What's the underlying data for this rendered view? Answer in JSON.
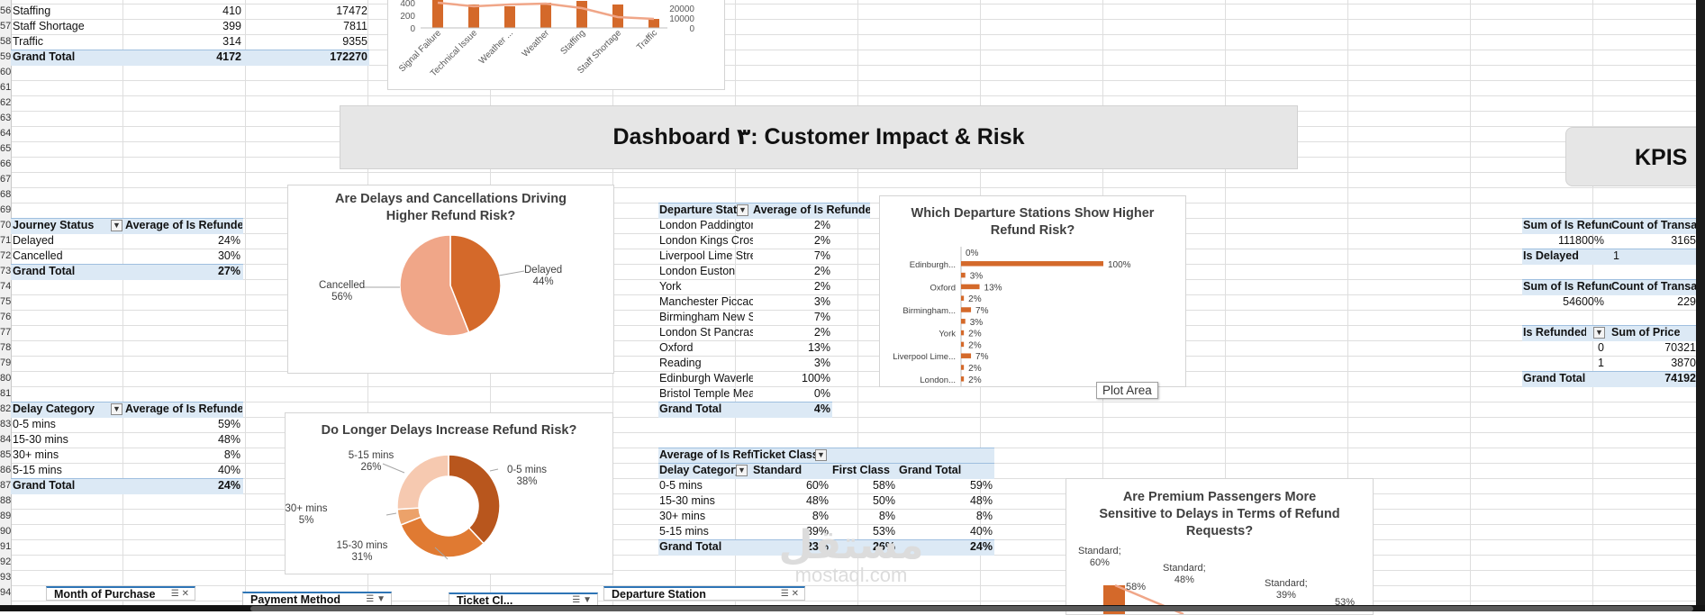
{
  "row_numbers": [
    "56",
    "57",
    "58",
    "59",
    "60",
    "61",
    "62",
    "63",
    "64",
    "65",
    "66",
    "67",
    "68",
    "69",
    "70",
    "71",
    "72",
    "73",
    "74",
    "75",
    "76",
    "77",
    "78",
    "79",
    "80",
    "81",
    "82",
    "83",
    "84",
    "85",
    "86",
    "87",
    "88",
    "89",
    "90",
    "91",
    "92",
    "93",
    "94"
  ],
  "top_pivot": {
    "rows": [
      {
        "label": "Staffing",
        "c1": "410",
        "c2": "17472"
      },
      {
        "label": "Staff Shortage",
        "c1": "399",
        "c2": "7811"
      },
      {
        "label": "Traffic",
        "c1": "314",
        "c2": "9355"
      }
    ],
    "total": {
      "label": "Grand Total",
      "c1": "4172",
      "c2": "172270"
    }
  },
  "top_chart": {
    "y_ticks_left": [
      "400",
      "200",
      "0"
    ],
    "y_ticks_right": [
      "20000",
      "10000",
      "0"
    ],
    "categories": [
      "Signal Failure",
      "Technical Issue",
      "Weather ...",
      "Weather",
      "Staffing",
      "Staff Shortage",
      "Traffic"
    ]
  },
  "banner": {
    "title": "Dashboard ٣: Customer Impact & Risk"
  },
  "kpis_label": "KPIS",
  "journey_pivot": {
    "h1": "Journey Status",
    "h2": "Average of Is Refunded",
    "rows": [
      {
        "label": "Delayed",
        "val": "24%"
      },
      {
        "label": "Cancelled",
        "val": "30%"
      }
    ],
    "total": {
      "label": "Grand Total",
      "val": "27%"
    }
  },
  "delay_pivot": {
    "h1": "Delay Category",
    "h2": "Average of Is Refunded",
    "rows": [
      {
        "label": "0-5 mins",
        "val": "59%"
      },
      {
        "label": "15-30 mins",
        "val": "48%"
      },
      {
        "label": "30+ mins",
        "val": "8%"
      },
      {
        "label": "5-15 mins",
        "val": "40%"
      }
    ],
    "total": {
      "label": "Grand Total",
      "val": "24%"
    }
  },
  "station_pivot": {
    "h1": "Departure Stati",
    "h2": "Average of Is Refunded",
    "rows": [
      {
        "label": "London Paddingtor",
        "val": "2%"
      },
      {
        "label": "London Kings Cros:",
        "val": "2%"
      },
      {
        "label": "Liverpool Lime Stre",
        "val": "7%"
      },
      {
        "label": "London Euston",
        "val": "2%"
      },
      {
        "label": "York",
        "val": "2%"
      },
      {
        "label": "Manchester Piccac",
        "val": "3%"
      },
      {
        "label": "Birmingham New S",
        "val": "7%"
      },
      {
        "label": "London St Pancras",
        "val": "2%"
      },
      {
        "label": "Oxford",
        "val": "13%"
      },
      {
        "label": "Reading",
        "val": "3%"
      },
      {
        "label": "Edinburgh Waverle",
        "val": "100%"
      },
      {
        "label": "Bristol Temple Mea",
        "val": "0%"
      }
    ],
    "total": {
      "label": "Grand Total",
      "val": "4%"
    }
  },
  "class_pivot": {
    "corner": "Average of Is Refur",
    "colfield": "Ticket Class",
    "rowfield": "Delay Category",
    "cols": [
      "Standard",
      "First Class",
      "Grand Total"
    ],
    "rows": [
      {
        "label": "0-5 mins",
        "v": [
          "60%",
          "58%",
          "59%"
        ]
      },
      {
        "label": "15-30 mins",
        "v": [
          "48%",
          "50%",
          "48%"
        ]
      },
      {
        "label": "30+ mins",
        "v": [
          "8%",
          "8%",
          "8%"
        ]
      },
      {
        "label": "5-15 mins",
        "v": [
          "39%",
          "53%",
          "40%"
        ]
      }
    ],
    "total": {
      "label": "Grand Total",
      "v": [
        "23%",
        "26%",
        "24%"
      ]
    }
  },
  "kpi_tables": {
    "t1_h1": "Sum of Is Refunde",
    "t1_h2": "Count of Transact",
    "t1_v1": "111800%",
    "t1_v2": "3165",
    "t1_r2_label": "Is Delayed",
    "t1_r2_val": "1",
    "t2_h1": "Sum of Is Refunde",
    "t2_h2": "Count of Transact",
    "t2_v1": "54600%",
    "t2_v2": "229",
    "t3_h1": "Is Refunded",
    "t3_h2": "Sum of Price",
    "t3_rows": [
      {
        "k": "0",
        "v": "70321"
      },
      {
        "k": "1",
        "v": "3870"
      }
    ],
    "t3_total_label": "Grand Total",
    "t3_total_val": "74192"
  },
  "chart_refund_pie": {
    "title_line1": "Are Delays and Cancellations Driving",
    "title_line2": "Higher Refund Risk?",
    "label_cancelled": "Cancelled",
    "pct_cancelled": "56%",
    "label_delayed": "Delayed",
    "pct_delayed": "44%"
  },
  "chart_delay_donut": {
    "title": "Do Longer Delays Increase Refund Risk?",
    "labels": [
      {
        "name": "0-5 mins",
        "pct": "38%"
      },
      {
        "name": "15-30 mins",
        "pct": "31%"
      },
      {
        "name": "30+ mins",
        "pct": "5%"
      },
      {
        "name": "5-15 mins",
        "pct": "26%"
      }
    ]
  },
  "chart_station_bar": {
    "title_line1": "Which Departure Stations Show Higher",
    "title_line2": "Refund Risk?",
    "category_labels": [
      "Edinburgh...",
      "Oxford",
      "Birmingham...",
      "York",
      "Liverpool Lime...",
      "London..."
    ],
    "bar_labels": [
      "0%",
      "100%",
      "3%",
      "13%",
      "2%",
      "7%",
      "3%",
      "2%",
      "2%",
      "7%",
      "2%",
      "2%"
    ]
  },
  "chart_premium": {
    "title_line1": "Are Premium Passengers More",
    "title_line2": "Sensitive to Delays in Terms of Refund",
    "title_line3": "Requests?",
    "label1_a": "Standard;",
    "label1_b": "60%",
    "label2_a": "Standard;",
    "label2_b": "48%",
    "label3_a": "Standard;",
    "label3_b": "39%",
    "label4": "58%",
    "label5": "53%"
  },
  "tooltip": "Plot Area",
  "slicers": {
    "month": "Month of Purchase",
    "payment": "Payment Method",
    "ticket": "Ticket Cl...",
    "station": "Departure Station"
  },
  "watermark": {
    "big": "مستقل",
    "small": "mostaql.com"
  },
  "chart_data": [
    {
      "type": "pie",
      "title": "Are Delays and Cancellations Driving Higher Refund Risk?",
      "categories": [
        "Delayed",
        "Cancelled"
      ],
      "values": [
        44,
        56
      ],
      "colors": [
        "#d4692a",
        "#f0a688"
      ]
    },
    {
      "type": "pie",
      "title": "Do Longer Delays Increase Refund Risk?",
      "categories": [
        "0-5 mins",
        "15-30 mins",
        "30+ mins",
        "5-15 mins"
      ],
      "values": [
        38,
        31,
        5,
        26
      ],
      "colors": [
        "#b8561d",
        "#e07a32",
        "#eca26a",
        "#f6c9b0"
      ]
    },
    {
      "type": "bar",
      "title": "Which Departure Stations Show Higher Refund Risk?",
      "categories": [
        "Bristol Temple Mea",
        "Edinburgh Waverle",
        "Reading",
        "Oxford",
        "London St Pancras",
        "Birmingham New S",
        "Manchester Piccac",
        "York",
        "London Euston",
        "Liverpool Lime Stre",
        "London Kings Cros:",
        "London Paddingtor"
      ],
      "values": [
        0,
        100,
        3,
        13,
        2,
        7,
        3,
        2,
        2,
        7,
        2,
        2
      ],
      "ylim": [
        0,
        100
      ]
    }
  ]
}
